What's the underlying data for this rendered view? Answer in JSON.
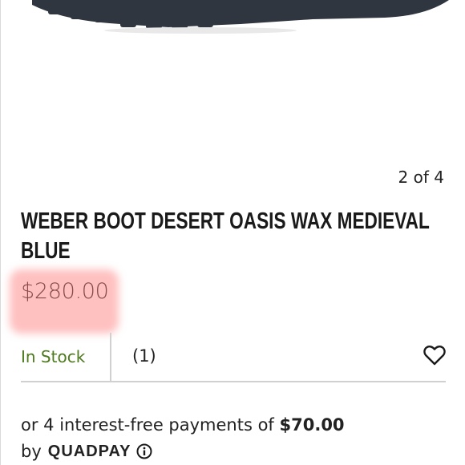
{
  "gallery": {
    "counter": "2 of 4"
  },
  "product": {
    "title": "WEBER BOOT DESERT OASIS WAX MEDIEVAL BLUE",
    "price": "$280.00",
    "stock_status": "In Stock",
    "review_count": "(1)"
  },
  "financing": {
    "prefix": "or 4 interest-free payments of ",
    "amount": "$70.00",
    "by": "by",
    "provider": "QUADPAY"
  },
  "colors": {
    "in_stock": "#4d7a1d",
    "price_highlight": "#ff8c8c",
    "boot": "#2f3640"
  },
  "icons": [
    "heart-icon",
    "info-icon"
  ]
}
